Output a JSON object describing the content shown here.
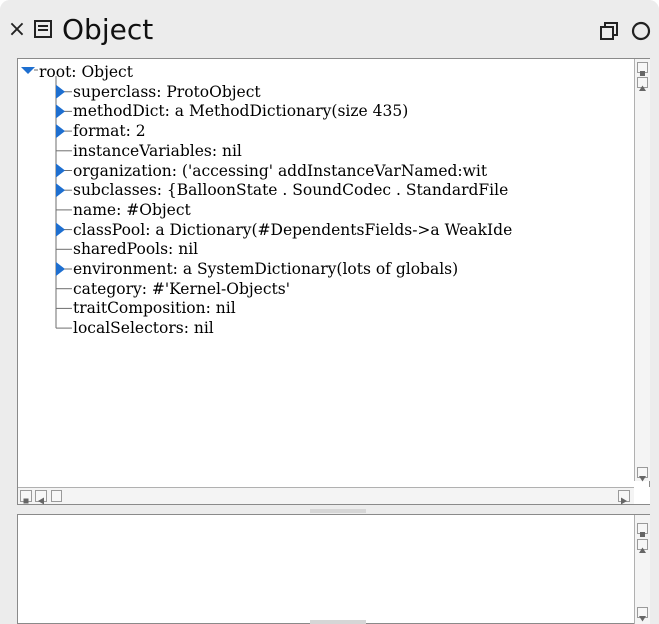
{
  "window": {
    "title": "Object",
    "close_icon": "×"
  },
  "tree": {
    "rows": [
      {
        "label": "root: Object",
        "expander": "expanded"
      },
      {
        "label": "superclass: ProtoObject",
        "expander": "collapsed"
      },
      {
        "label": "methodDict: a MethodDictionary(size 435)",
        "expander": "collapsed"
      },
      {
        "label": "format: 2",
        "expander": "collapsed"
      },
      {
        "label": "instanceVariables: nil",
        "expander": "none"
      },
      {
        "label": "organization: ('accessing' addInstanceVarNamed:wit",
        "expander": "collapsed"
      },
      {
        "label": "subclasses: {BalloonState . SoundCodec . StandardFile",
        "expander": "collapsed"
      },
      {
        "label": "name: #Object",
        "expander": "none"
      },
      {
        "label": "classPool: a Dictionary(#DependentsFields->a WeakIde",
        "expander": "collapsed"
      },
      {
        "label": "sharedPools: nil",
        "expander": "none"
      },
      {
        "label": "environment: a SystemDictionary(lots of globals)",
        "expander": "collapsed"
      },
      {
        "label": "category: #'Kernel-Objects'",
        "expander": "none"
      },
      {
        "label": "traitComposition: nil",
        "expander": "none"
      },
      {
        "label": "localSelectors: nil",
        "expander": "none"
      }
    ]
  },
  "icons": {
    "close": "close-icon",
    "menu": "window-menu-icon",
    "collapse": "collapse-window-icon",
    "expand": "expand-window-icon",
    "expanded_triangle": "expanded-triangle-icon",
    "collapsed_triangle": "collapsed-triangle-icon"
  },
  "colors": {
    "window_bg": "#ececec",
    "pane_bg": "#ffffff",
    "triangle": "#1e6fd0",
    "tree_line": "#6e6e6e"
  }
}
